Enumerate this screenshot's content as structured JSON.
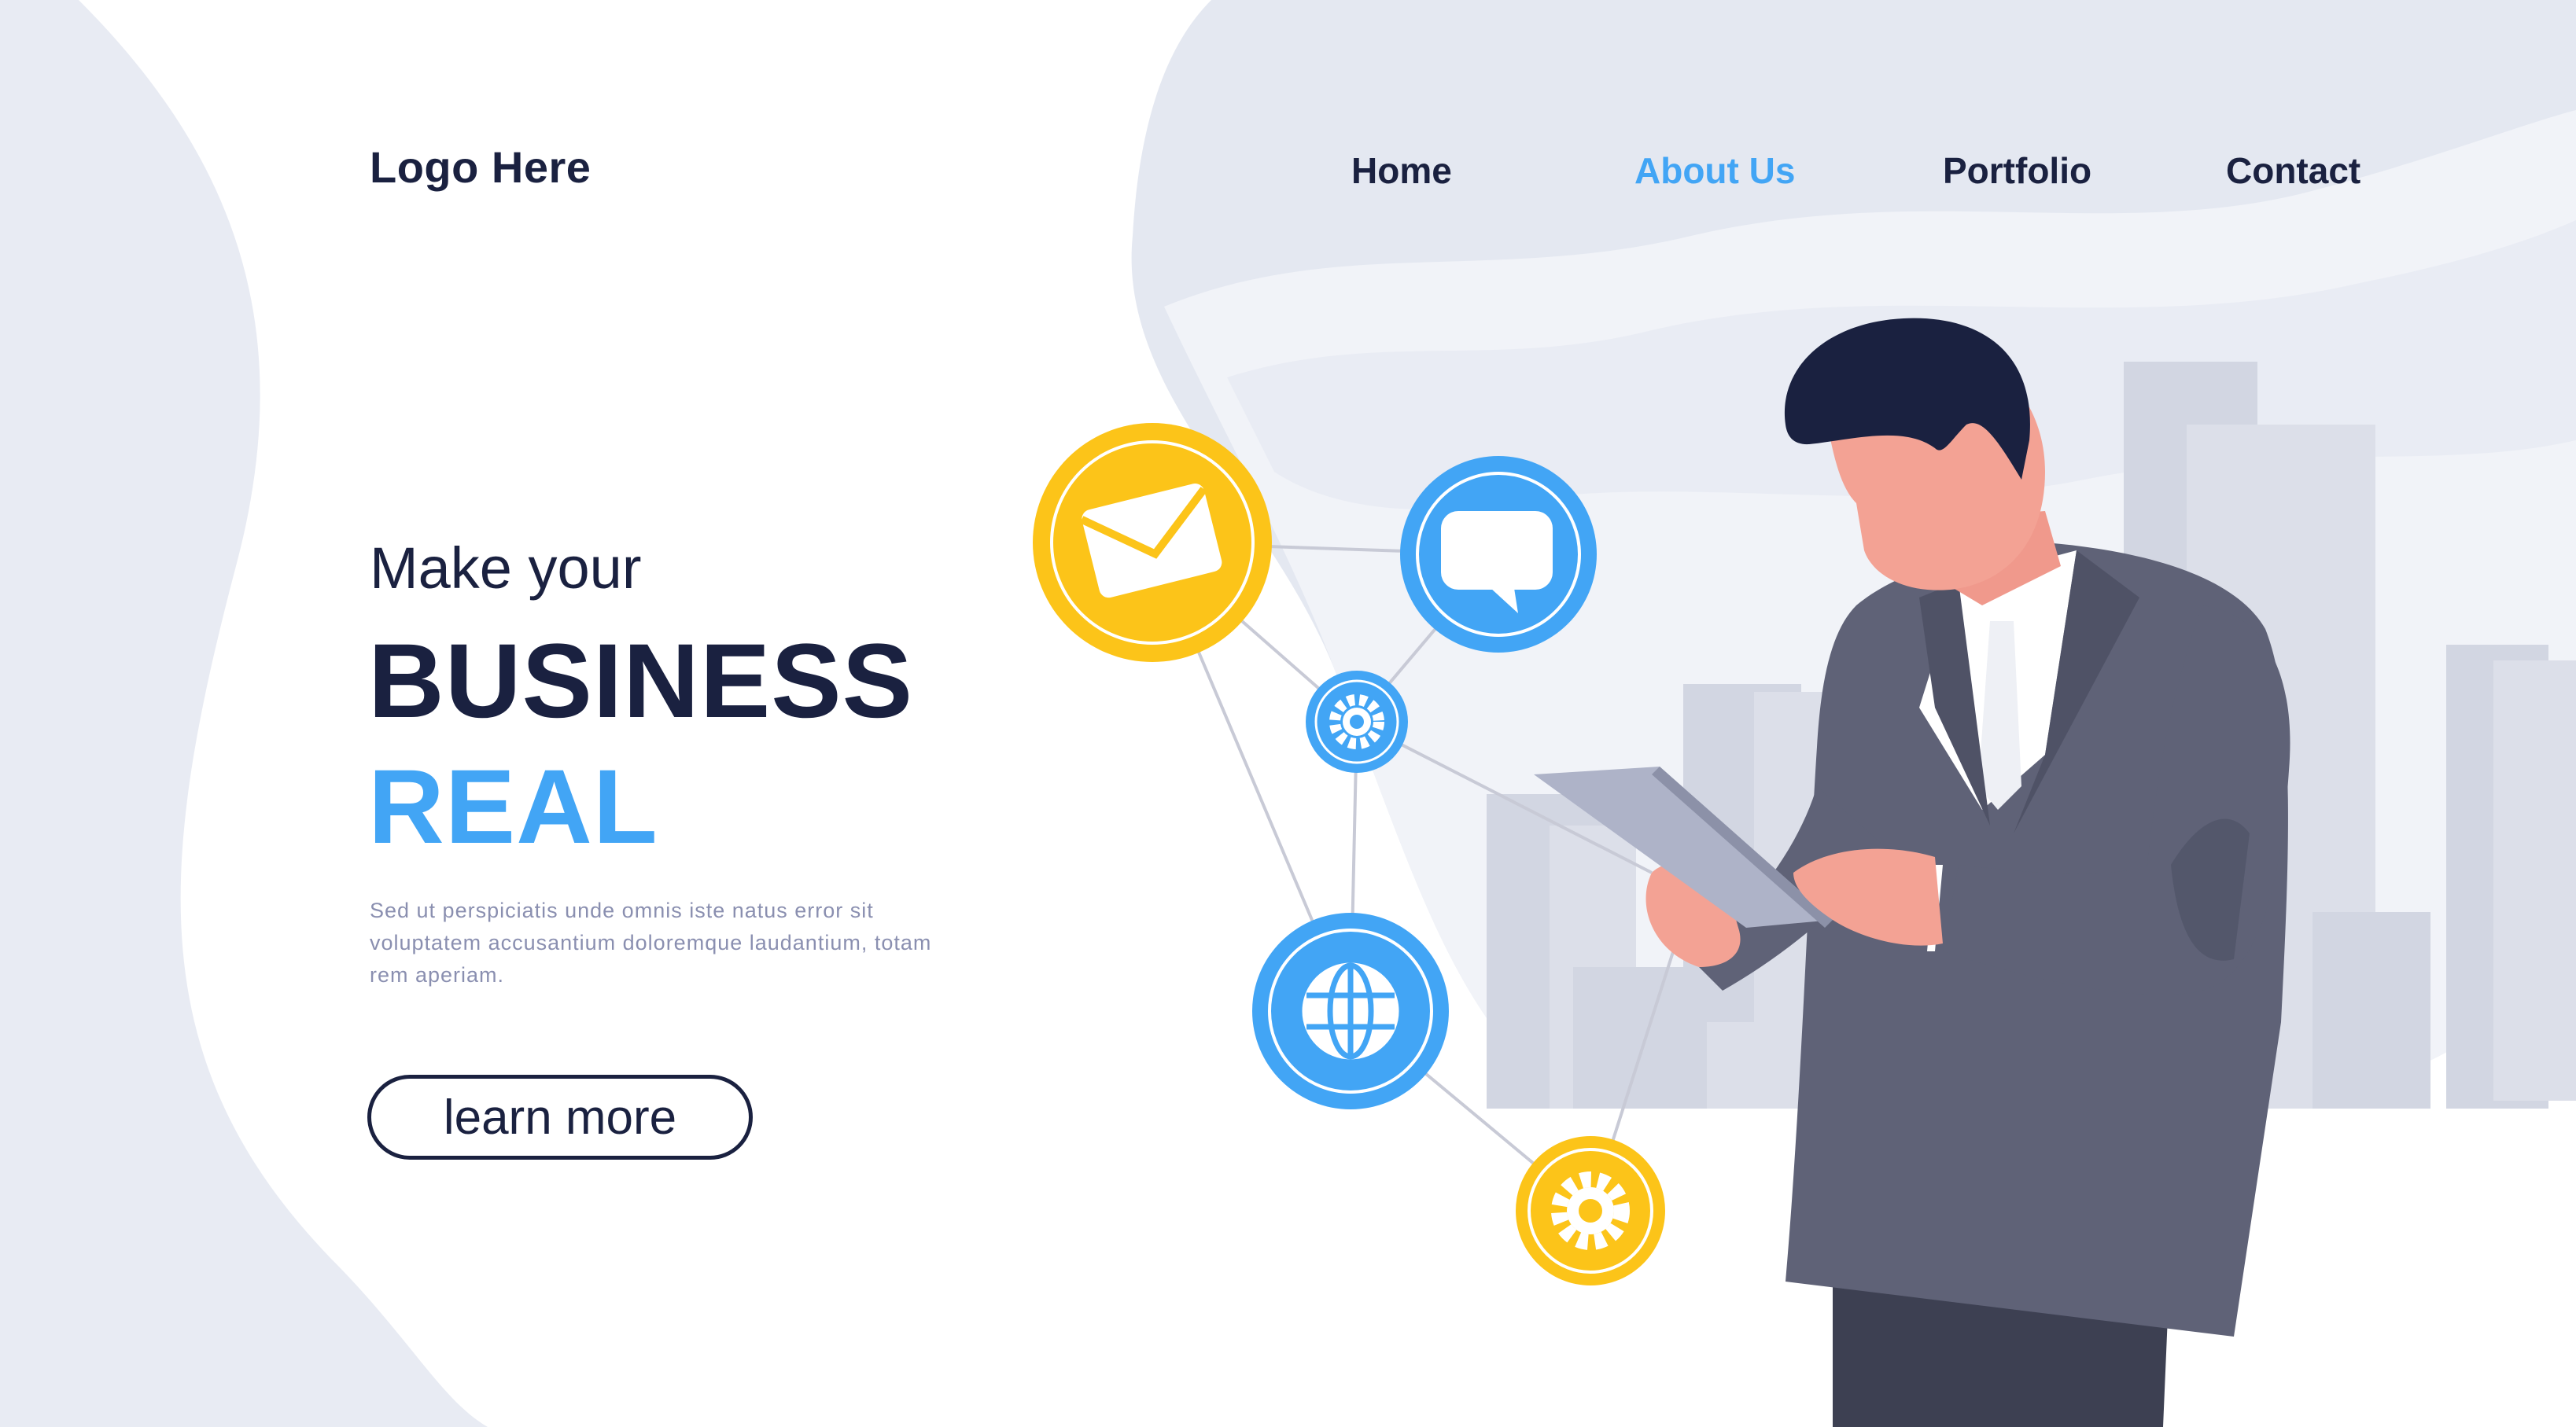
{
  "header": {
    "logo_text": "Logo Here",
    "nav": [
      {
        "label": "Home",
        "active": false
      },
      {
        "label": "About Us",
        "active": true
      },
      {
        "label": "Portfolio",
        "active": false
      },
      {
        "label": "Contact",
        "active": false
      }
    ]
  },
  "hero": {
    "pre_title": "Make your",
    "title": "BUSINESS",
    "title_accent": "REAL",
    "description": "Sed ut perspiciatis unde omnis iste natus error sit voluptatem accusantium doloremque laudantium, totam rem aperiam.",
    "cta_label": "learn more"
  },
  "illustration": {
    "network_icons": [
      "envelope-icon",
      "chat-bubble-icon",
      "gear-icon",
      "globe-icon",
      "gear-icon"
    ]
  },
  "colors": {
    "navy": "#1a2140",
    "accent_blue": "#42a5f5",
    "yellow": "#fcc419",
    "background_tint": "#e4e8f1",
    "suit": "#5f6277"
  }
}
